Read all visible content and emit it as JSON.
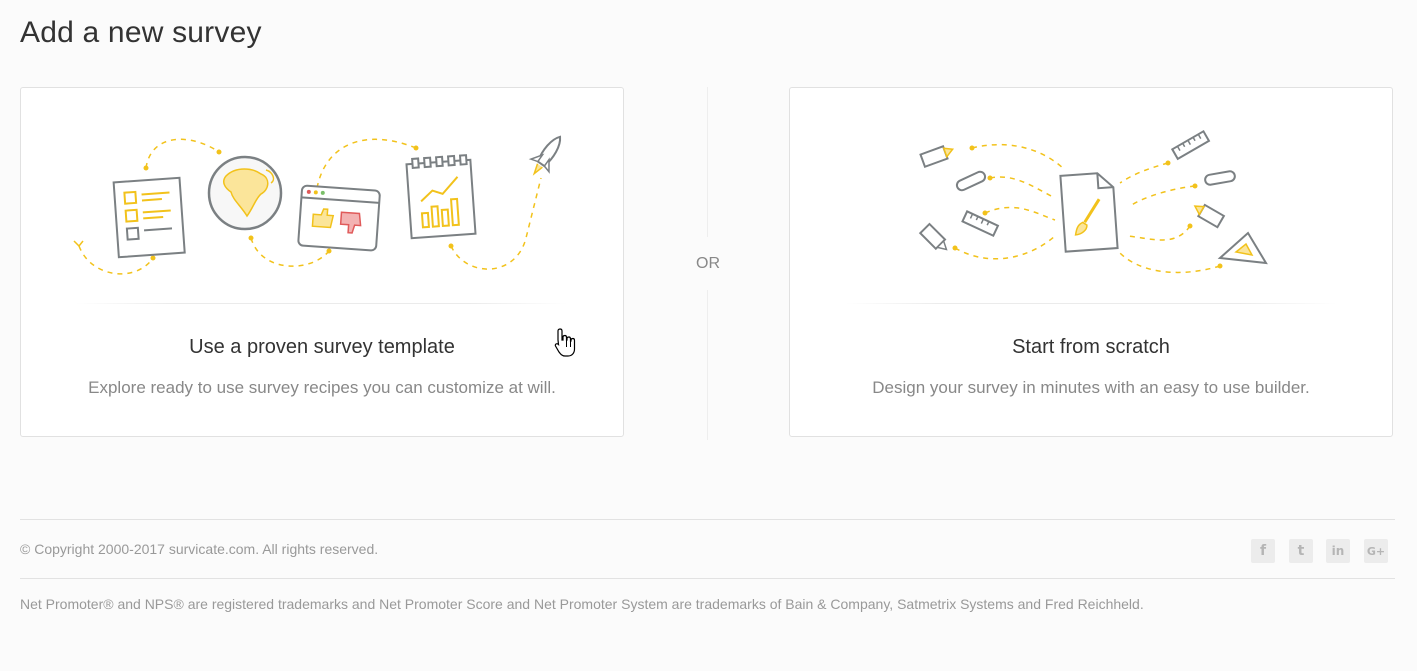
{
  "page": {
    "title": "Add a new survey"
  },
  "options": {
    "template": {
      "title": "Use a proven survey template",
      "description": "Explore ready to use survey recipes you can customize at will."
    },
    "separator": "OR",
    "scratch": {
      "title": "Start from scratch",
      "description": "Design your survey in minutes with an easy to use builder."
    }
  },
  "footer": {
    "copyright": "© Copyright 2000-2017 survicate.com. All rights reserved.",
    "social": [
      {
        "name": "facebook-icon",
        "glyph": "f"
      },
      {
        "name": "twitter-icon",
        "glyph": "t"
      },
      {
        "name": "linkedin-icon",
        "glyph": "in"
      },
      {
        "name": "google-plus-icon",
        "glyph": "G+"
      }
    ],
    "trademark": "Net Promoter® and NPS® are registered trademarks and Net Promoter Score and Net Promoter System are trademarks of Bain & Company, Satmetrix Systems and Fred Reichheld."
  },
  "colors": {
    "accent": "#f2c21b",
    "outline": "#7b8083",
    "thumb_down": "#e05a5a"
  }
}
